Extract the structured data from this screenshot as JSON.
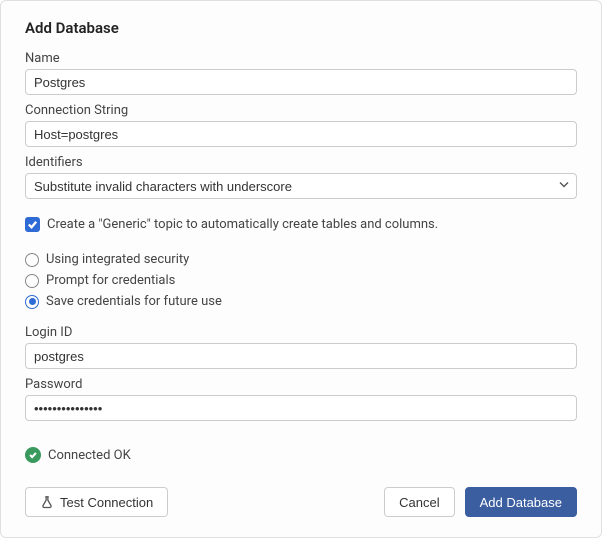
{
  "title": "Add Database",
  "fields": {
    "name_label": "Name",
    "name_value": "Postgres",
    "conn_label": "Connection String",
    "conn_value": "Host=postgres",
    "ident_label": "Identifiers",
    "ident_value": "Substitute invalid characters with underscore",
    "login_label": "Login ID",
    "login_value": "postgres",
    "password_label": "Password",
    "password_value": "•••••••••••••••"
  },
  "checkbox": {
    "create_generic": "Create a \"Generic\" topic to automatically create tables and columns."
  },
  "radios": {
    "integrated": "Using integrated security",
    "prompt": "Prompt for credentials",
    "save": "Save credentials for future use"
  },
  "status": {
    "text": "Connected OK"
  },
  "buttons": {
    "test": "Test Connection",
    "cancel": "Cancel",
    "add": "Add Database"
  }
}
